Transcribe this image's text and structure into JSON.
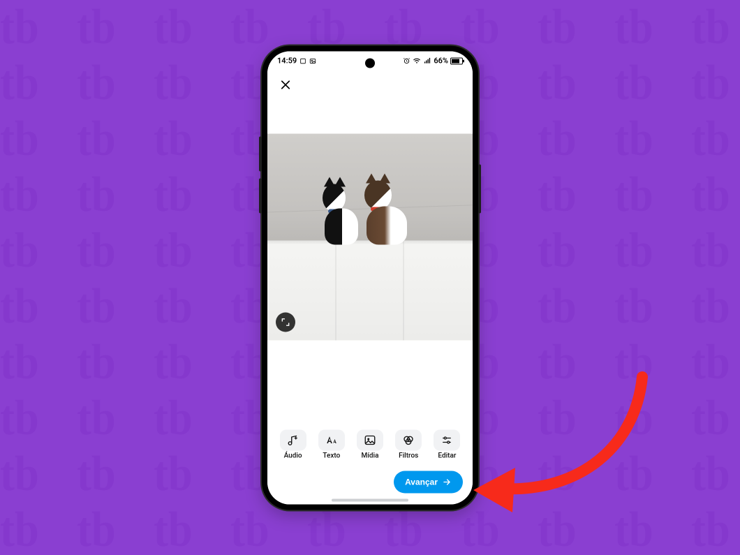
{
  "status_bar": {
    "time": "14:59",
    "battery_label": "66%",
    "battery_level": 66
  },
  "app_bar": {
    "close_icon": "close-icon"
  },
  "media": {
    "description": "Two cats sitting on top of a white wardrobe",
    "expand_icon": "expand-icon"
  },
  "tools": [
    {
      "key": "audio",
      "icon": "music-note-plus-icon",
      "label": "Áudio"
    },
    {
      "key": "text",
      "icon": "text-aa-icon",
      "label": "Texto"
    },
    {
      "key": "media",
      "icon": "image-icon",
      "label": "Mídia"
    },
    {
      "key": "filters",
      "icon": "filters-rings-icon",
      "label": "Filtros"
    },
    {
      "key": "edit",
      "icon": "sliders-icon",
      "label": "Editar"
    }
  ],
  "primary_action": {
    "label": "Avançar",
    "icon": "arrow-right-icon"
  },
  "colors": {
    "page_bg": "#8A3FD1",
    "primary_button": "#0098EE",
    "annotation_arrow": "#F72A1B"
  }
}
